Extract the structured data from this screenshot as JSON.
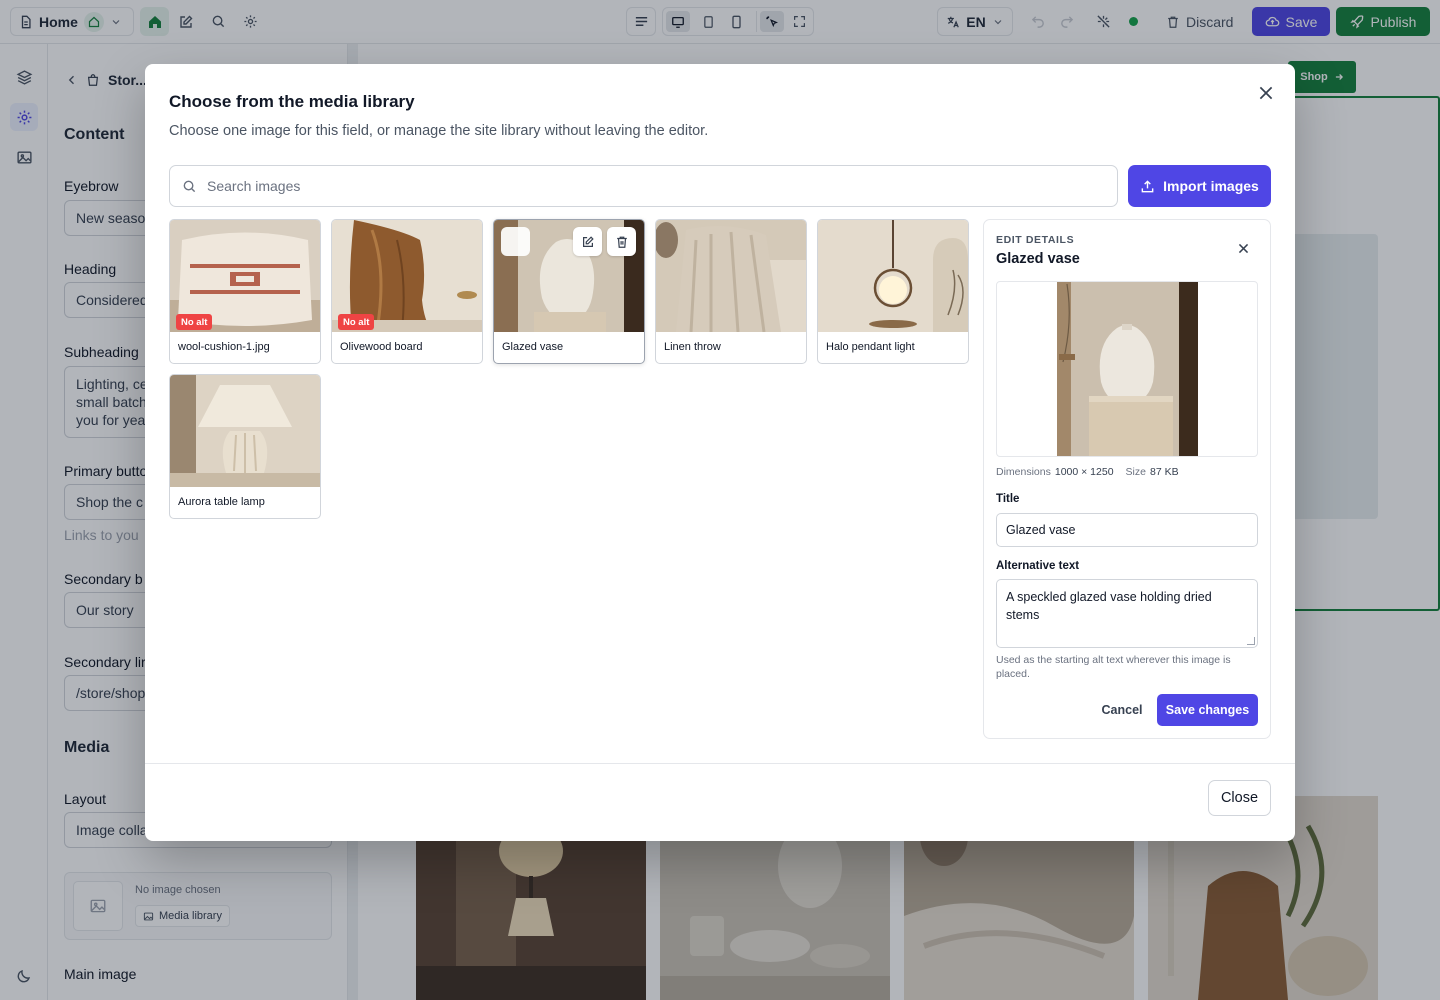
{
  "topbar": {
    "page_label": "Home",
    "language": "EN",
    "discard_label": "Discard",
    "save_label": "Save",
    "publish_label": "Publish"
  },
  "panel": {
    "breadcrumb": "Stor...",
    "content_heading": "Content",
    "fields": {
      "eyebrow": {
        "label": "Eyebrow",
        "value": "New seaso"
      },
      "heading": {
        "label": "Heading",
        "value": "Considered"
      },
      "subheading": {
        "label": "Subheading",
        "line1": "Lighting, ce",
        "line2": "small batch",
        "line3": "you for yea"
      },
      "primary_button": {
        "label": "Primary butto",
        "value": "Shop the c",
        "hint": "Links to you"
      },
      "secondary_button": {
        "label": "Secondary b",
        "value": "Our story"
      },
      "secondary_link": {
        "label": "Secondary lir",
        "value": "/store/shop"
      }
    },
    "media_heading": "Media",
    "layout": {
      "label": "Layout",
      "value": "Image colla"
    },
    "media_picker": {
      "empty_text": "No image chosen",
      "button_label": "Media library"
    },
    "main_image_label": "Main image"
  },
  "canvas": {
    "shop_button_label": "Shop"
  },
  "modal": {
    "title": "Choose from the media library",
    "subtitle": "Choose one image for this field, or manage the site library without leaving the editor.",
    "search_placeholder": "Search images",
    "import_label": "Import images",
    "no_alt_badge": "No alt",
    "images": [
      {
        "name": "wool-cushion-1.jpg",
        "missing_alt": true
      },
      {
        "name": "Olivewood board",
        "missing_alt": true
      },
      {
        "name": "Glazed vase",
        "missing_alt": false,
        "selected": true
      },
      {
        "name": "Linen throw",
        "missing_alt": false
      },
      {
        "name": "Halo pendant light",
        "missing_alt": false
      },
      {
        "name": "Aurora table lamp",
        "missing_alt": false
      }
    ],
    "details": {
      "eyebrow": "EDIT DETAILS",
      "title": "Glazed vase",
      "dimensions_label": "Dimensions",
      "dimensions_value": "1000 × 1250",
      "size_label": "Size",
      "size_value": "87 KB",
      "title_field_label": "Title",
      "title_field_value": "Glazed vase",
      "alt_field_label": "Alternative text",
      "alt_field_value": "A speckled glazed vase holding dried stems",
      "alt_help": "Used as the starting alt text wherever this image is placed.",
      "cancel_label": "Cancel",
      "save_label": "Save changes"
    },
    "close_label": "Close"
  },
  "colors": {
    "accent": "#4f46e5",
    "publish": "#15803d",
    "danger_badge": "#ef4444"
  },
  "icons": [
    "document-icon",
    "home-icon",
    "chevron-down-icon",
    "edit-icon",
    "search-icon",
    "gear-icon",
    "text-align-icon",
    "desktop-icon",
    "tablet-icon",
    "phone-icon",
    "pointer-icon",
    "fullscreen-icon",
    "translate-icon",
    "undo-icon",
    "redo-icon",
    "sparkle-off-icon",
    "trash-icon",
    "cloud-upload-icon",
    "rocket-icon",
    "layers-icon",
    "image-icon",
    "moon-icon",
    "close-icon",
    "upload-icon",
    "pencil-icon",
    "arrow-right-icon",
    "bag-icon",
    "chevron-left-icon"
  ]
}
